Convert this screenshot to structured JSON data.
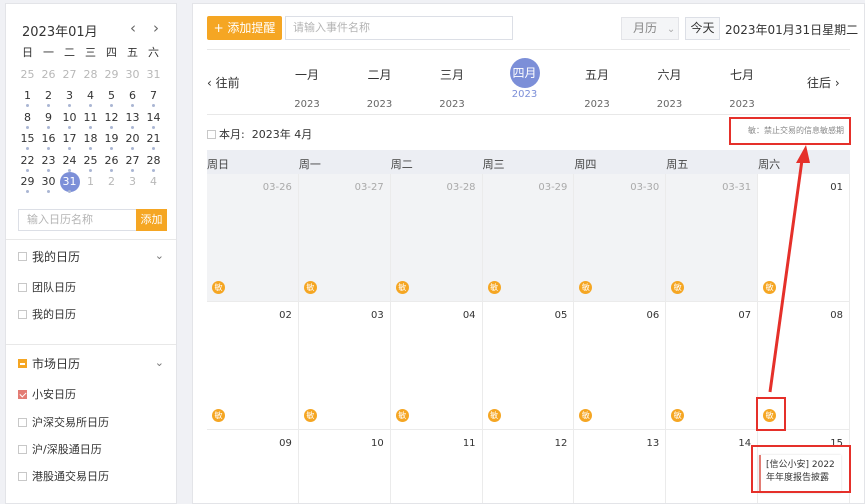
{
  "mini_calendar": {
    "title": "2023年01月",
    "prev": "‹",
    "next": "›",
    "weekdays": [
      "日",
      "一",
      "二",
      "三",
      "四",
      "五",
      "六"
    ],
    "weeks": [
      [
        "25",
        "26",
        "27",
        "28",
        "29",
        "30",
        "31"
      ],
      [
        "1",
        "2",
        "3",
        "4",
        "5",
        "6",
        "7"
      ],
      [
        "8",
        "9",
        "10",
        "11",
        "12",
        "13",
        "14"
      ],
      [
        "15",
        "16",
        "17",
        "18",
        "19",
        "20",
        "21"
      ],
      [
        "22",
        "23",
        "24",
        "25",
        "26",
        "27",
        "28"
      ],
      [
        "29",
        "30",
        "31",
        "1",
        "2",
        "3",
        "4"
      ]
    ],
    "selected": "31"
  },
  "calendar_input": {
    "placeholder": "输入日历名称",
    "add_label": "添加"
  },
  "my_calendars": {
    "title": "我的日历",
    "items": [
      "团队日历",
      "我的日历"
    ]
  },
  "market_calendars": {
    "title": "市场日历",
    "items": [
      {
        "label": "小安日历",
        "checked": true
      },
      {
        "label": "沪深交易所日历",
        "checked": false
      },
      {
        "label": "沪/深股通日历",
        "checked": false
      },
      {
        "label": "港股通交易日历",
        "checked": false
      }
    ]
  },
  "toolbar": {
    "add_label": "+ 添加提醒",
    "event_placeholder": "请输入事件名称",
    "view": "月历",
    "today": "今天",
    "current_date": "2023年01月31日星期二"
  },
  "months": {
    "prev": "‹ 往前",
    "next": "往后 ›",
    "items": [
      {
        "month": "一月",
        "year": "2023"
      },
      {
        "month": "二月",
        "year": "2023"
      },
      {
        "month": "三月",
        "year": "2023"
      },
      {
        "month": "四月",
        "year": "2023",
        "active": true
      },
      {
        "month": "五月",
        "year": "2023"
      },
      {
        "month": "六月",
        "year": "2023"
      },
      {
        "month": "七月",
        "year": "2023"
      }
    ]
  },
  "current_month": {
    "label": "本月:",
    "value": "2023年 4月"
  },
  "legend_text": "敏：禁止交易的信息敏感期",
  "weekdays": [
    "周日",
    "周一",
    "周二",
    "周三",
    "周四",
    "周五",
    "周六"
  ],
  "weeks": [
    [
      "03-26",
      "03-27",
      "03-28",
      "03-29",
      "03-30",
      "03-31",
      "01"
    ],
    [
      "02",
      "03",
      "04",
      "05",
      "06",
      "07",
      "08"
    ],
    [
      "09",
      "10",
      "11",
      "12",
      "13",
      "14",
      "15"
    ]
  ],
  "badge_label": "敏",
  "event": {
    "title": "[信公小安] 2022年年度报告披露"
  },
  "colors": {
    "accent": "#f5a623",
    "selected": "#7c8fd8",
    "highlight": "#e5302a"
  }
}
